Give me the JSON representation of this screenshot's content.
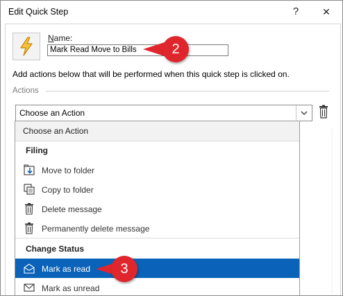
{
  "window": {
    "title": "Edit Quick Step",
    "help_glyph": "?",
    "close_glyph": "✕"
  },
  "quick_step": {
    "icon": "lightning-bolt-icon",
    "name_label_accel": "N",
    "name_label_rest": "ame:",
    "name_value": "Mark Read Move to Bills",
    "description": "Add actions below that will be performed when this quick step is clicked on."
  },
  "actions": {
    "section_label": "Actions",
    "select_value": "Choose an Action"
  },
  "dropdown": {
    "first_option": "Choose an Action",
    "groups": [
      {
        "header": "Filing",
        "items": [
          {
            "label": "Move to folder",
            "icon": "move-to-folder-icon"
          },
          {
            "label": "Copy to folder",
            "icon": "copy-to-folder-icon"
          },
          {
            "label": "Delete message",
            "icon": "trash-icon"
          },
          {
            "label": "Permanently delete message",
            "icon": "trash-icon"
          }
        ]
      },
      {
        "header": "Change Status",
        "items": [
          {
            "label": "Mark as read",
            "icon": "open-envelope-icon",
            "selected": true
          },
          {
            "label": "Mark as unread",
            "icon": "closed-envelope-icon"
          }
        ]
      }
    ]
  },
  "callouts": [
    "2",
    "3"
  ],
  "colors": {
    "selection": "#0a63b8",
    "callout": "#e0262d",
    "bolt": "#f2a900"
  }
}
